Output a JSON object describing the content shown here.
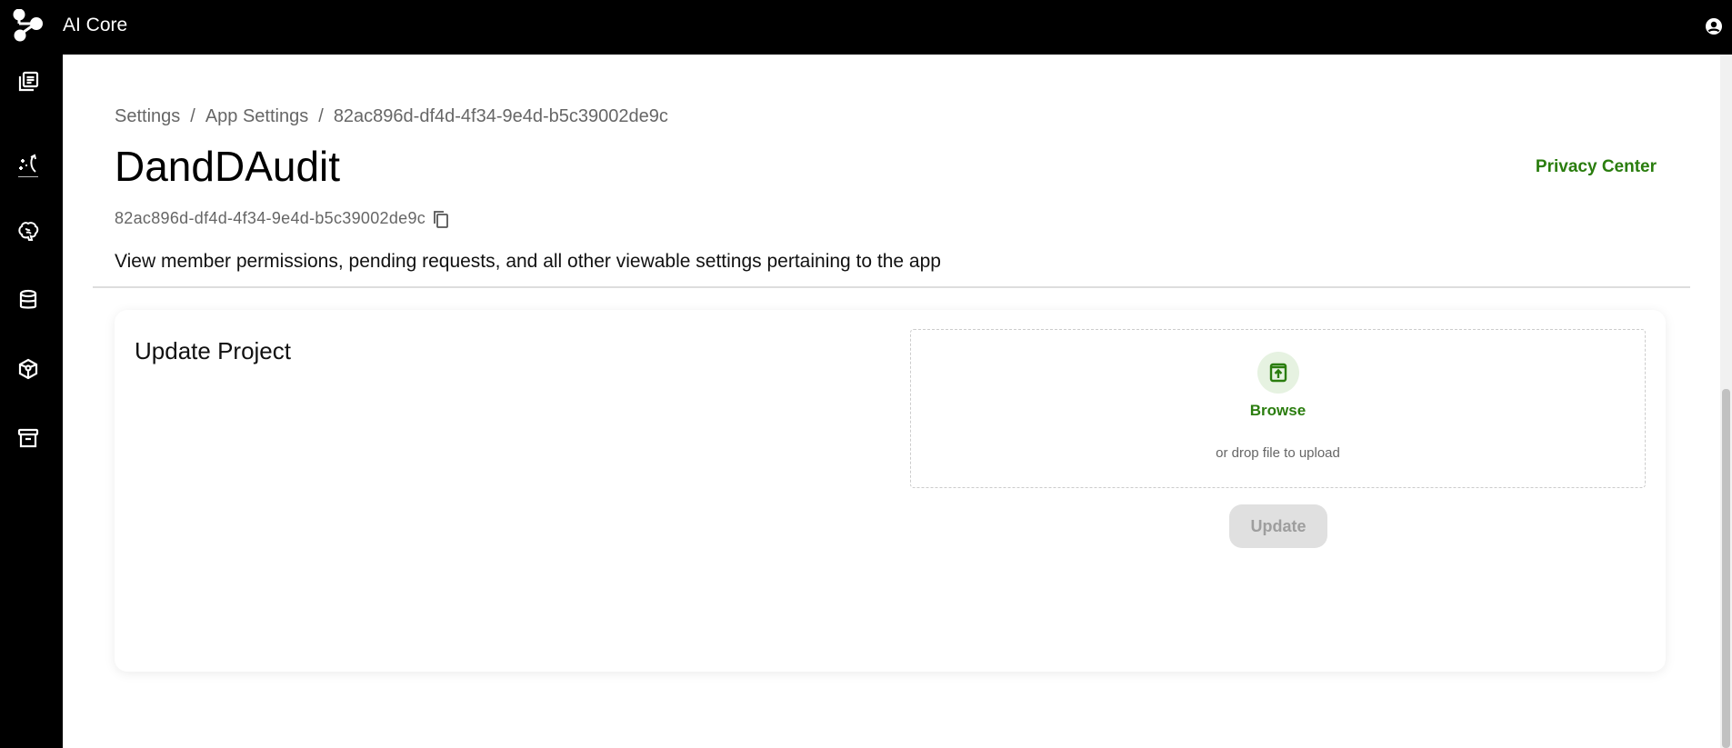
{
  "app": {
    "title": "AI Core"
  },
  "breadcrumb": [
    "Settings",
    "App Settings",
    "82ac896d-df4d-4f34-9e4d-b5c39002de9c"
  ],
  "header": {
    "title": "DandDAudit",
    "privacy_link": "Privacy Center",
    "app_id": "82ac896d-df4d-4f34-9e4d-b5c39002de9c",
    "description": "View member permissions, pending requests, and all other viewable settings pertaining to the app"
  },
  "card": {
    "title": "Update Project",
    "browse_label": "Browse",
    "drop_text": "or drop file to upload",
    "update_label": "Update"
  },
  "colors": {
    "accent": "#2a7d0e",
    "topbar": "#000000"
  }
}
